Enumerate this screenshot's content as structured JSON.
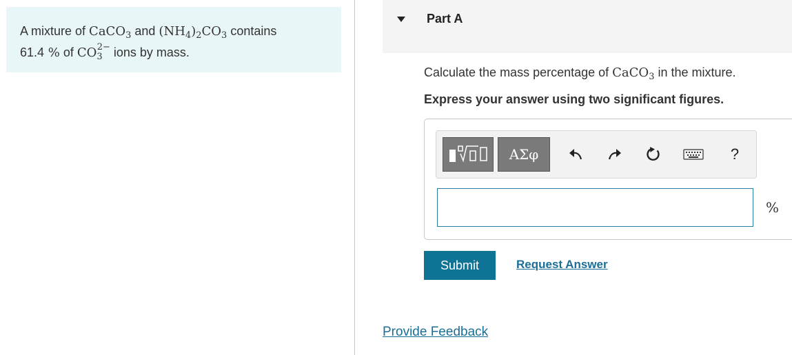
{
  "problem": {
    "t1": "A mixture of ",
    "caco3_main": "CaCO",
    "caco3_sub": "3",
    "t2": " and ",
    "nh4_main_a": "(NH",
    "nh4_sub_a": "4",
    "nh4_main_b": ")",
    "nh4_sub_b": "2",
    "nh4_main_c": "CO",
    "nh4_sub_c": "3",
    "t3": " contains",
    "pct_value": "61.4",
    "pct_symbol": " %",
    "t4": " of ",
    "ion_main": "CO",
    "ion_sub": "3",
    "ion_charge": "2−",
    "t5": " ions by mass."
  },
  "part": {
    "title": "Part A",
    "question_a": "Calculate the mass percentage of ",
    "question_formula": "CaCO",
    "question_sub": "3",
    "question_b": " in the mixture.",
    "instruction": "Express your answer using two significant figures."
  },
  "toolbar": {
    "templates_icon": "templates-icon",
    "greek_label": "ΑΣφ",
    "undo_icon": "undo-icon",
    "redo_icon": "redo-icon",
    "reset_icon": "reset-icon",
    "keyboard_icon": "keyboard-icon",
    "help_label": "?"
  },
  "answer": {
    "value": "",
    "unit": "%"
  },
  "actions": {
    "submit_label": "Submit",
    "request_label": "Request Answer",
    "feedback_label": "Provide Feedback"
  },
  "colors": {
    "intro_bg": "#e9f6f8",
    "accent": "#0f7396",
    "link": "#1b6f96"
  }
}
